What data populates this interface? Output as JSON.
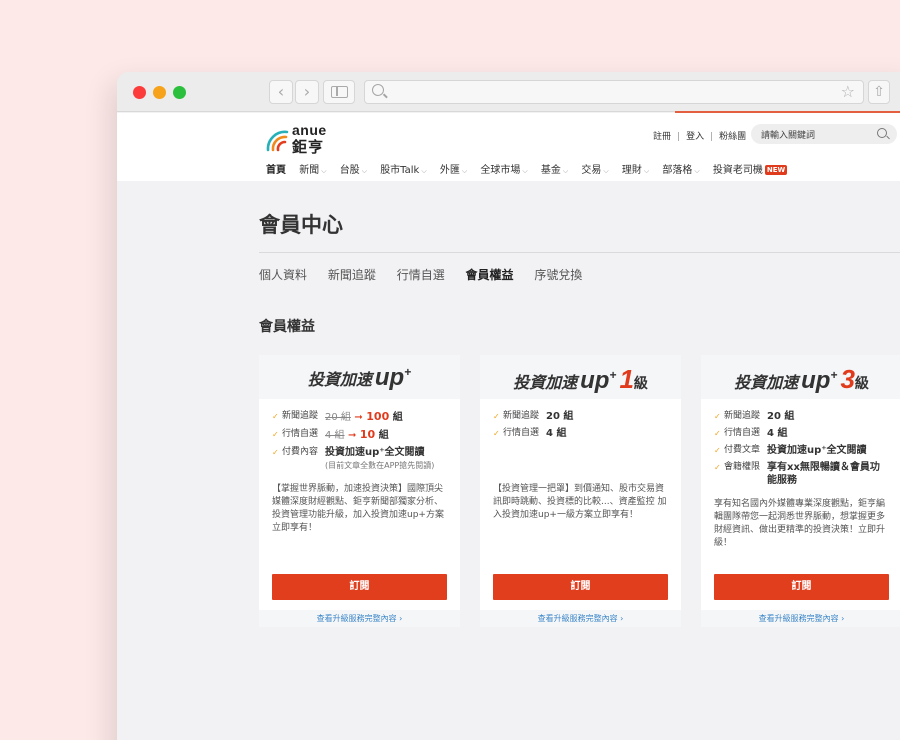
{
  "browser": {
    "back_icon": "‹",
    "forward_icon": "›",
    "star_icon": "☆",
    "share_icon": "⇧"
  },
  "header": {
    "logo_en": "anue",
    "logo_zh": "鉅亨",
    "top_links": [
      "註冊",
      "登入",
      "粉絲團"
    ],
    "search_placeholder": "請輸入關鍵詞",
    "nav": [
      {
        "label": "首頁",
        "active": true,
        "caret": false
      },
      {
        "label": "新聞",
        "caret": true
      },
      {
        "label": "台股",
        "caret": true
      },
      {
        "label": "股市Talk",
        "caret": true
      },
      {
        "label": "外匯",
        "caret": true
      },
      {
        "label": "全球市場",
        "caret": true
      },
      {
        "label": "基金",
        "caret": true
      },
      {
        "label": "交易",
        "caret": true
      },
      {
        "label": "理財",
        "caret": true
      },
      {
        "label": "部落格",
        "caret": true
      },
      {
        "label": "投資老司機",
        "badge": "NEW"
      }
    ]
  },
  "page": {
    "title": "會員中心",
    "subnav": [
      "個人資料",
      "新聞追蹤",
      "行情自選",
      "會員權益",
      "序號兌換"
    ],
    "subnav_active": "會員權益",
    "section_title": "會員權益"
  },
  "cards": [
    {
      "brand": "投資加速",
      "up": "up",
      "plus": "+",
      "level": "",
      "level_suffix": "",
      "features": [
        {
          "label": "新聞追蹤",
          "old": "20 組",
          "arrow": "➞",
          "new": "100",
          "unit": "組"
        },
        {
          "label": "行情自選",
          "old": "4 組",
          "arrow": "➞",
          "new": "10",
          "unit": "組"
        },
        {
          "label": "付費內容",
          "value": "投資加速up⁺全文閱讀",
          "note": "(目前文章全數在APP搶先閱讀)"
        }
      ],
      "description": "【掌握世界脈動，加速投資決策】國際頂尖媒體深度財經觀點、鉅亨新聞部獨家分析、投資管理功能升級，加入投資加速up+方案立即享有！",
      "button": "訂閱",
      "more_link": "查看升級服務完整內容 ›"
    },
    {
      "brand": "投資加速",
      "up": "up",
      "plus": "+",
      "level": "1",
      "level_suffix": "級",
      "features": [
        {
          "label": "新聞追蹤",
          "value": "20 組"
        },
        {
          "label": "行情自選",
          "value": "4 組"
        }
      ],
      "description": "【投資管理一把罩】到價通知、股市交易資訊即時跳動、投資標的比較...、資產監控 加入投資加速up+一級方案立即享有！",
      "button": "訂閱",
      "more_link": "查看升級服務完整內容 ›"
    },
    {
      "brand": "投資加速",
      "up": "up",
      "plus": "+",
      "level": "3",
      "level_suffix": "級",
      "features": [
        {
          "label": "新聞追蹤",
          "value": "20 組"
        },
        {
          "label": "行情自選",
          "value": "4 組"
        },
        {
          "label": "付費文章",
          "value": "投資加速up⁺全文閱讀"
        },
        {
          "label": "會籍權限",
          "value": "享有xx無限暢讀＆會員功能服務"
        }
      ],
      "description": "享有知名國內外媒體專業深度觀點，鉅亨編輯團隊帶您一起洞悉世界脈動，想掌握更多財經資訊、做出更精準的投資決策！立即升級！",
      "button": "訂閱",
      "more_link": "查看升級服務完整內容 ›"
    }
  ]
}
